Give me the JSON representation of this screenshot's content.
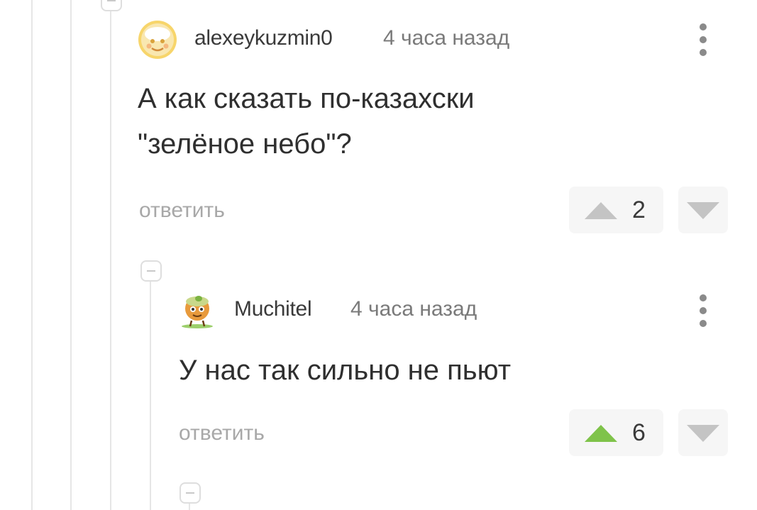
{
  "comments": [
    {
      "username": "alexeykuzmin0",
      "time": "4 часа назад",
      "text_lines": [
        "А как сказать по-казахски",
        "\"зелёное небо\"?"
      ],
      "reply_label": "ответить",
      "rating": "2",
      "upvote_state": "neutral",
      "avatar_icon": "cartoon-face-avatar"
    },
    {
      "username": "Muchitel",
      "time": "4 часа назад",
      "text_lines": [
        "У нас так сильно не пьют"
      ],
      "reply_label": "ответить",
      "rating": "6",
      "upvote_state": "upvoted",
      "avatar_icon": "cartoon-character-avatar"
    }
  ],
  "colors": {
    "upvoted": "#7fc34a",
    "neutral_arrow": "#c4c4c4",
    "thread_line": "#e6e6e6",
    "vote_box_bg": "#f6f6f6"
  }
}
